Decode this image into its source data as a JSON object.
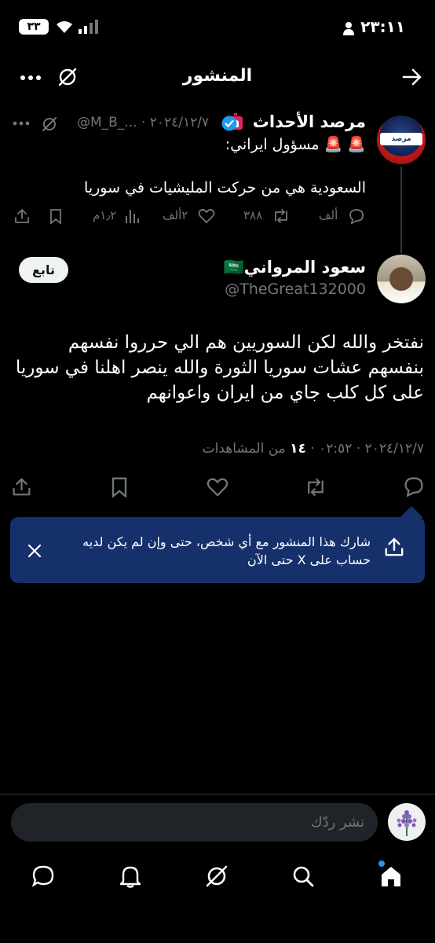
{
  "status_bar": {
    "time": "٢٣:١١",
    "battery": "٣٣"
  },
  "header": {
    "title": "المنشور"
  },
  "quoted_post": {
    "author_name": "مرصد الأحداث",
    "meta": "@M_B_... · ٢٠٢٤/١٢/٧",
    "line1": "🚨 🚨 مسؤول ايراني:",
    "line2": "السعودية هي من حركت المليشيات في سوريا",
    "replies": "ألف",
    "reposts": "٣٨٨",
    "likes": "٢ألف",
    "views": "١٫٢م",
    "avatar_text": "مرصد الأحداث"
  },
  "main_post": {
    "author_name": "سعود المرواني🇸🇦",
    "handle": "@TheGreat132000",
    "follow_label": "تابع",
    "body": "نفتخر والله لكن السوريين هم الي حرروا نفسهم بنفسهم عشات سوريا الثورة والله ينصر اهلنا في سوريا على كل كلب جاي من ايران واعوانهم",
    "timestamp": "٢٠٢٤/١٢/٧ · ٠٢:٥٢ · ",
    "views_count": "١٤",
    "views_label": " من المشاهدات"
  },
  "share_banner": {
    "text": "شارك هذا المنشور مع أي شخص، حتى وإن لم يكن لديه حساب على X حتى الآن"
  },
  "reply_bar": {
    "placeholder": "نشر ردّك"
  },
  "colors": {
    "background": "#000000",
    "banner": "#16306b",
    "accent": "#1d9bf0",
    "muted": "#71767b"
  },
  "icons": [
    "back-arrow-icon",
    "grok-icon",
    "more-icon",
    "verified-icon",
    "reply-icon",
    "repost-icon",
    "like-icon",
    "views-icon",
    "bookmark-icon",
    "share-icon",
    "close-icon",
    "home-icon",
    "search-icon",
    "notifications-icon",
    "messages-icon"
  ]
}
